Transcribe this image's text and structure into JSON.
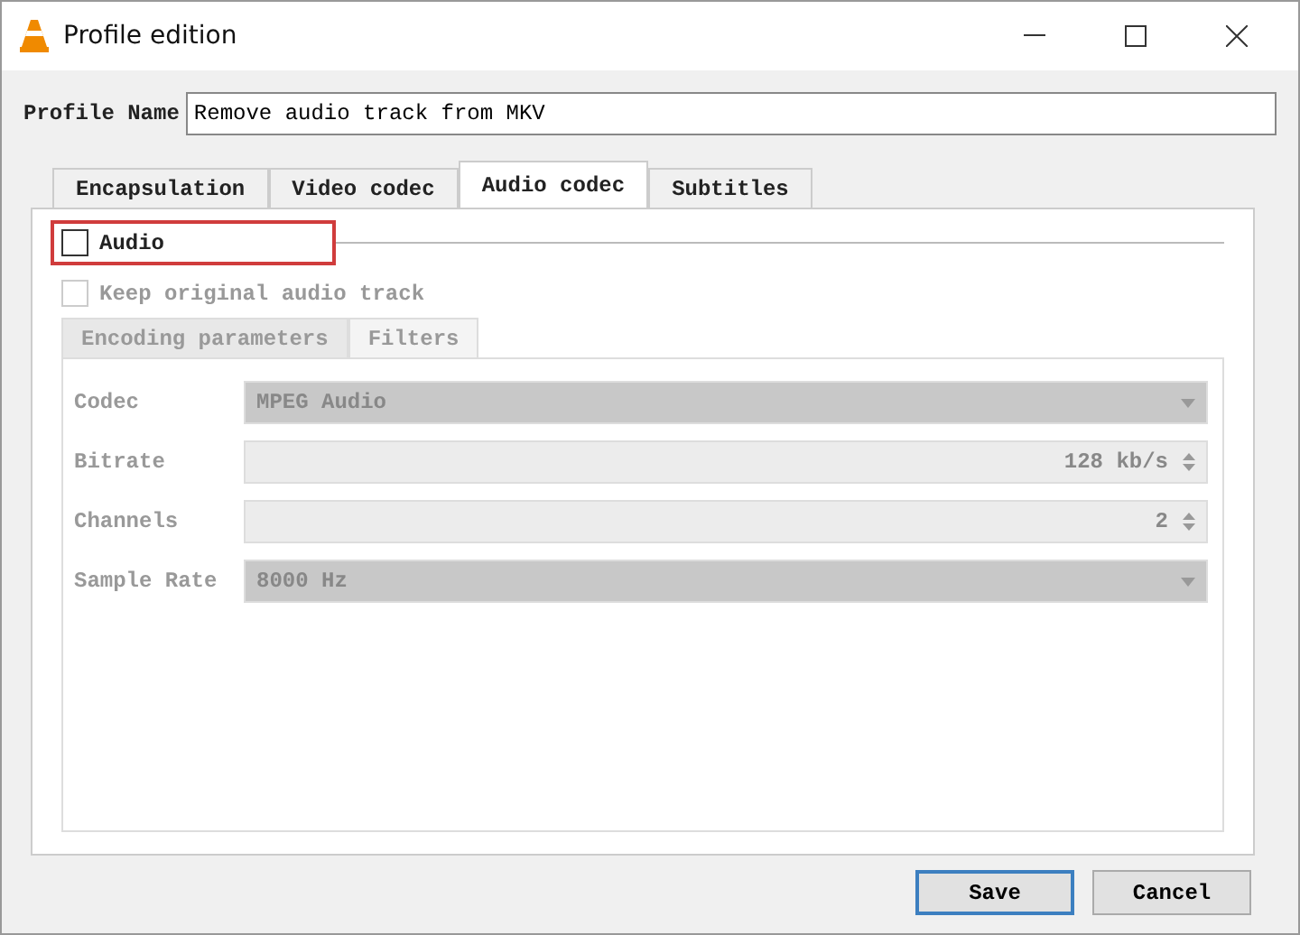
{
  "window": {
    "title": "Profile edition"
  },
  "profile_name": {
    "label": "Profile Name",
    "value": "Remove audio track from MKV"
  },
  "tabs": [
    {
      "label": "Encapsulation",
      "selected": false
    },
    {
      "label": "Video codec",
      "selected": false
    },
    {
      "label": "Audio codec",
      "selected": true
    },
    {
      "label": "Subtitles",
      "selected": false
    }
  ],
  "audio": {
    "label": "Audio",
    "checked": false,
    "highlighted": true
  },
  "keep_original": {
    "label": "Keep original audio track",
    "checked": false,
    "disabled": true
  },
  "sub_tabs": [
    {
      "label": "Encoding parameters",
      "selected": true
    },
    {
      "label": "Filters",
      "selected": false
    }
  ],
  "fields": [
    {
      "kind": "select",
      "label": "Codec",
      "value": "MPEG Audio"
    },
    {
      "kind": "spin",
      "label": "Bitrate",
      "value": "128 kb/s"
    },
    {
      "kind": "spin",
      "label": "Channels",
      "value": "2"
    },
    {
      "kind": "select",
      "label": "Sample Rate",
      "value": "8000 Hz"
    }
  ],
  "buttons": [
    {
      "label": "Save",
      "default": true
    },
    {
      "label": "Cancel",
      "default": false
    }
  ]
}
